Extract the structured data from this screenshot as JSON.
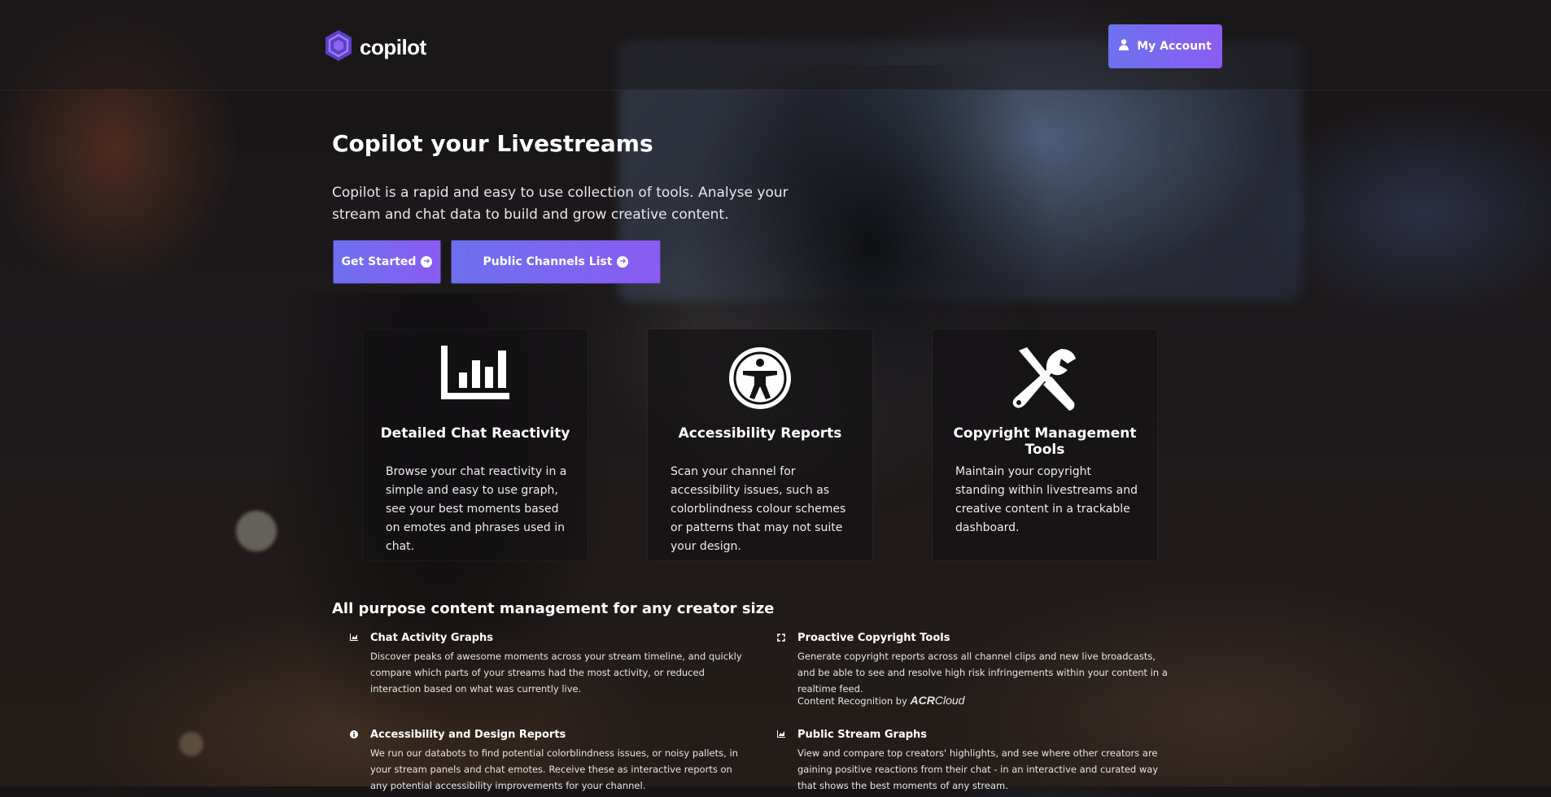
{
  "brand": {
    "name": "copilot",
    "logo_icon": "hexagon-logo-icon",
    "accent": "#7b61f0"
  },
  "header": {
    "account_label": "My Account",
    "account_icon": "user-icon"
  },
  "hero": {
    "title": "Copilot your Livestreams",
    "description": "Copilot is a rapid and easy to use collection of tools. Analyse your stream and chat data to build and grow creative content.",
    "buttons": [
      {
        "label": "Get Started",
        "icon": "arrow-circle-right-icon"
      },
      {
        "label": "Public Channels List",
        "icon": "arrow-circle-right-icon"
      }
    ]
  },
  "cards": [
    {
      "icon": "bar-chart-icon",
      "title": "Detailed Chat Reactivity",
      "text": "Browse your chat reactivity in a simple and easy to use graph, see your best moments based on emotes and phrases used in chat."
    },
    {
      "icon": "accessibility-icon",
      "title": "Accessibility Reports",
      "text": "Scan your channel for accessibility issues, such as colorblindness colour schemes or patterns that may not suite your design."
    },
    {
      "icon": "tools-icon",
      "title": "Copyright Management Tools",
      "text": "Maintain your copyright standing within livestreams and creative content in a trackable dashboard."
    }
  ],
  "section": {
    "title": "All purpose content management for any creator size",
    "features": [
      {
        "icon": "area-chart-icon",
        "title": "Chat Activity Graphs",
        "text": "Discover peaks of awesome moments across your stream timeline, and quickly compare which parts of your streams had the most activity, or reduced interaction based on what was currently live."
      },
      {
        "icon": "expand-icon",
        "title": "Proactive Copyright Tools",
        "text": "Generate copyright reports across all channel clips and new live broadcasts, and be able to see and resolve high risk infringements within your content in a realtime feed.",
        "recognition_label": "Content Recognition by",
        "recognition_brand_a": "ACR",
        "recognition_brand_b": "Cloud"
      },
      {
        "icon": "info-circle-icon",
        "title": "Accessibility and Design Reports",
        "text": "We run our databots to find potential colorblindness issues, or noisy pallets, in your stream panels and chat emotes. Receive these as interactive reports on any potential accessibility improvements for your channel."
      },
      {
        "icon": "area-chart-icon",
        "title": "Public Stream Graphs",
        "text": "View and compare top creators' highlights, and see where other creators are gaining positive reactions from their chat - in an interactive and curated way that shows the best moments of any stream."
      }
    ]
  }
}
